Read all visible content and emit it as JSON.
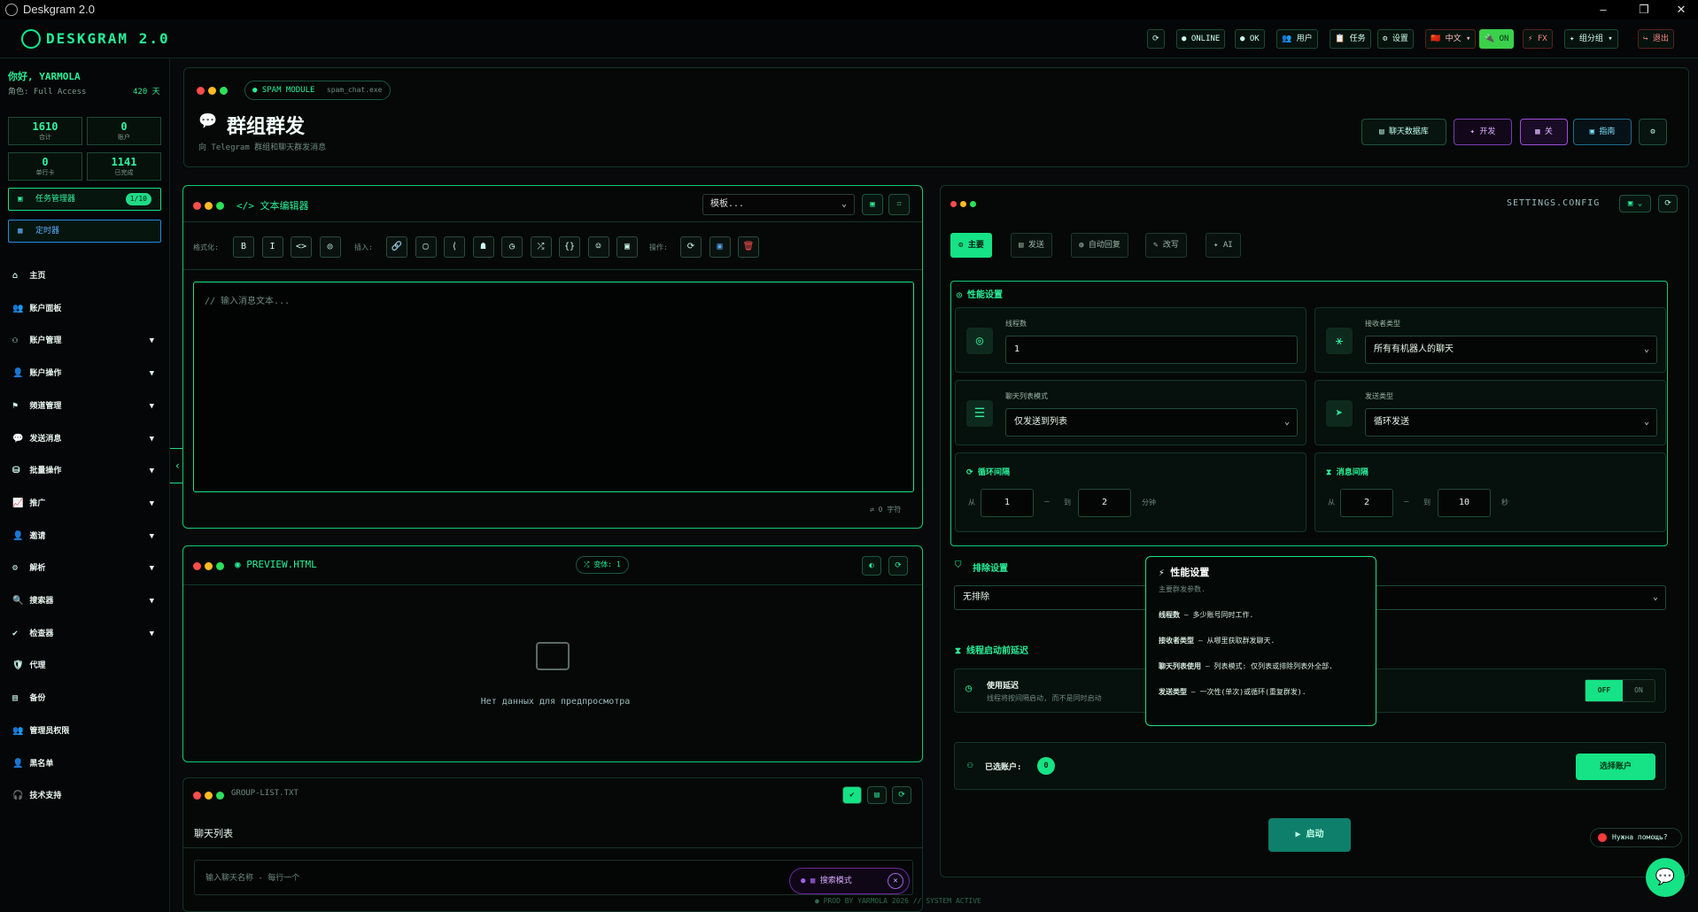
{
  "window": {
    "title": "Deskgram 2.0",
    "minimize": "–",
    "maximize": "❐",
    "close": "✕"
  },
  "header": {
    "logo": "DESKGRAM 2.0",
    "buttons": [
      "⟳",
      "● ONLINE",
      "● OK",
      "👥 用户",
      "📋 任务",
      "⚙ 设置",
      "🇨🇳 中文 ▾",
      "🔌 ON",
      "⚡ FX",
      "✦ 组分组 ▾",
      "↪ 退出"
    ]
  },
  "sidebar": {
    "greeting": "你好, YARMOLA",
    "role": "角色: Full Access",
    "days": "420 天",
    "stats": [
      {
        "v": "1610",
        "l": "合计"
      },
      {
        "v": "0",
        "l": "账户"
      },
      {
        "v": "0",
        "l": "单行卡"
      },
      {
        "v": "1141",
        "l": "已完成"
      }
    ],
    "task_btn": "任务管理器",
    "task_badge": "1/10",
    "schedule_btn": "定时器",
    "nav": [
      {
        "label": "主页",
        "icon": "⌂",
        "caret": false
      },
      {
        "label": "账户面板",
        "icon": "👥",
        "caret": false
      },
      {
        "label": "账户管理",
        "icon": "⚇",
        "caret": true
      },
      {
        "label": "账户操作",
        "icon": "👤",
        "caret": true
      },
      {
        "label": "频道管理",
        "icon": "⚑",
        "caret": true
      },
      {
        "label": "发送消息",
        "icon": "💬",
        "caret": true
      },
      {
        "label": "批量操作",
        "icon": "⛁",
        "caret": true
      },
      {
        "label": "推广",
        "icon": "📈",
        "caret": true
      },
      {
        "label": "邀请",
        "icon": "👤",
        "caret": true
      },
      {
        "label": "解析",
        "icon": "⚙",
        "caret": true
      },
      {
        "label": "搜索器",
        "icon": "🔍",
        "caret": true
      },
      {
        "label": "检查器",
        "icon": "✔",
        "caret": true
      },
      {
        "label": "代理",
        "icon": "🛡",
        "caret": false
      },
      {
        "label": "备份",
        "icon": "▤",
        "caret": false
      },
      {
        "label": "管理员权限",
        "icon": "👥",
        "caret": false
      },
      {
        "label": "黑名单",
        "icon": "👤",
        "caret": false
      },
      {
        "label": "技术支持",
        "icon": "🎧",
        "caret": false
      }
    ]
  },
  "module": {
    "badge": "SPAM MODULE",
    "file": "spam_chat.exe",
    "title": "群组群发",
    "subtitle": "向 Telegram 群组和聊天群发消息",
    "actions": [
      "▤ 聊天数据库",
      "✦ 开发",
      "▦ 关",
      "▣ 指南",
      "⚙"
    ]
  },
  "editor": {
    "title": "</> 文本编辑器",
    "template": "模板...",
    "format_label": "格式化:",
    "insert_label": "插入:",
    "ops_label": "操作:",
    "format_tools": [
      "B",
      "I",
      "<>",
      "◎"
    ],
    "insert_tools": [
      "🔗",
      "▢",
      "⟨",
      "☗",
      "◷",
      "⤮",
      "{}",
      "☺",
      "▣"
    ],
    "op_tools": [
      "⟳",
      "▣",
      "🗑"
    ],
    "placeholder": "// 输入消息文本...",
    "count": "⇄ 0 字符"
  },
  "preview": {
    "title": "◉ PREVIEW.HTML",
    "variants": "⤮ 变体: 1",
    "empty": "Нет данных для предпросмотра"
  },
  "group_list": {
    "title": "GROUP-LIST.TXT",
    "subtitle": "聊天列表",
    "placeholder": "输入聊天名称 - 每行一个"
  },
  "settings": {
    "title": "SETTINGS.CONFIG",
    "tabs": [
      "⚙ 主要",
      "▤ 发送",
      "◍ 自动回复",
      "✎ 改写",
      "✦ AI"
    ],
    "perf_title": "◎ 性能设置",
    "threads_label": "线程数",
    "threads_value": "1",
    "recv_label": "接收者类型",
    "recv_value": "所有有机器人的聊天",
    "chatlist_label": "聊天列表模式",
    "chatlist_value": "仅发送到列表",
    "send_label": "发送类型",
    "send_value": "循环发送",
    "cycle_title": "⟳ 循环间隔",
    "cycle_from": "从",
    "cycle_to": "到",
    "cycle_a": "1",
    "cycle_b": "2",
    "cycle_unit": "分钟",
    "msg_title": "⧗ 消息间隔",
    "msg_from": "从",
    "msg_to": "到",
    "msg_a": "2",
    "msg_b": "10",
    "msg_unit": "秒",
    "exclude_title": "排除设置",
    "exclude_value": "无排除",
    "delay_title": "⧗ 线程启动前延迟",
    "delay_label": "使用延迟",
    "delay_desc": "线程将按间隔启动, 而不是同时启动",
    "off": "OFF",
    "on": "ON",
    "accounts_label": "已选账户:",
    "accounts_count": "0",
    "select_btn": "选择账户",
    "start_btn": "▶ 启动"
  },
  "tooltip": {
    "title": "⚡ 性能设置",
    "intro": "主要群发参数.",
    "l1k": "线程数",
    "l1v": " — 多少账号同时工作.",
    "l2k": "接收者类型",
    "l2v": " — 从哪里获取群发聊天.",
    "l3k": "聊天列表使用",
    "l3v": " — 列表模式: 仅列表或排除列表外全部.",
    "l4k": "发送类型",
    "l4v": " — 一次性(单次)或循环(重复群发)."
  },
  "floating": {
    "spam_pill": "搜索模式",
    "help": "Нужна помощь?"
  },
  "footer": "● PROD BY YARMOLA 2026  // SYSTEM ACTIVE"
}
